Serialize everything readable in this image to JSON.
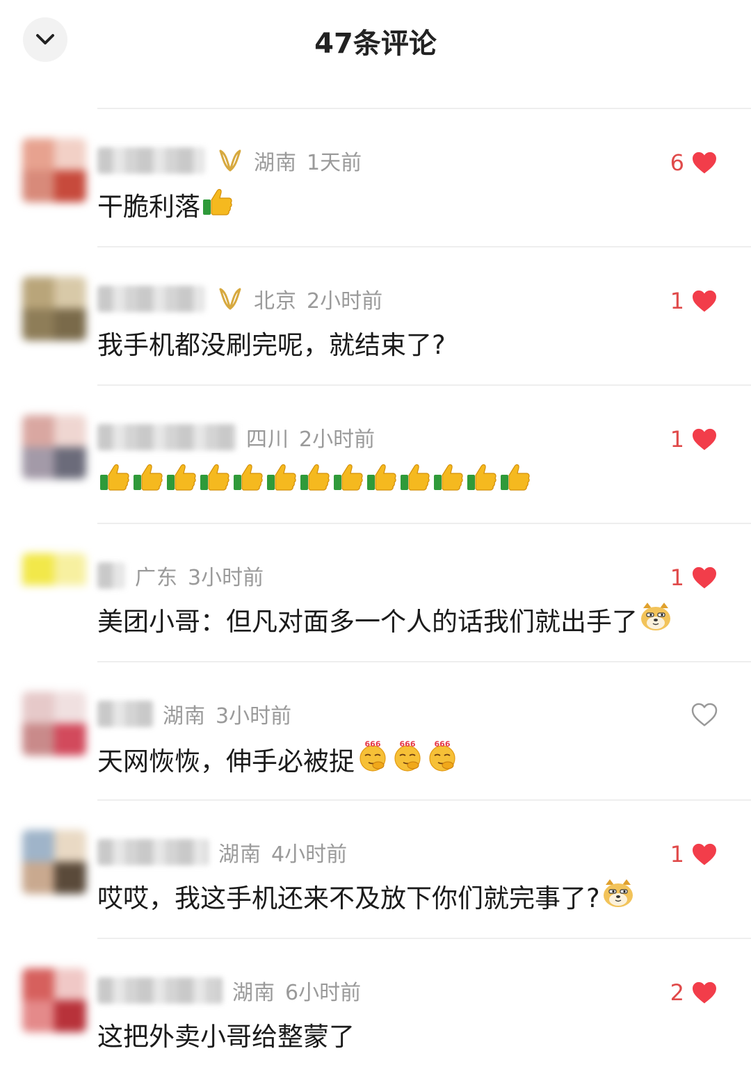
{
  "header": {
    "title": "47条评论",
    "back_icon": "chevron-down-icon"
  },
  "colors": {
    "heart_filled": "#f23d4a",
    "heart_empty": "#999999",
    "count": "#e04a4a",
    "badge_gold": "#d7a93f"
  },
  "comments": [
    {
      "location": "湖南",
      "time": "1天前",
      "text": "干脆利落",
      "emoji": "thumbs-up",
      "emoji_count": 1,
      "likes": "6",
      "liked": true,
      "badge": true
    },
    {
      "location": "北京",
      "time": "2小时前",
      "text": "我手机都没刷完呢，就结束了?",
      "emoji": "",
      "emoji_count": 0,
      "likes": "1",
      "liked": true,
      "badge": true
    },
    {
      "location": "四川",
      "time": "2小时前",
      "text": "",
      "emoji": "thumbs-up",
      "emoji_count": 13,
      "likes": "1",
      "liked": true,
      "badge": false
    },
    {
      "location": "广东",
      "time": "3小时前",
      "text": "美团小哥：但凡对面多一个人的话我们就出手了",
      "emoji": "doge",
      "emoji_count": 1,
      "likes": "1",
      "liked": true,
      "badge": false
    },
    {
      "location": "湖南",
      "time": "3小时前",
      "text": "天网恢恢，伸手必被捉",
      "emoji": "666-face",
      "emoji_count": 3,
      "likes": "",
      "liked": false,
      "badge": false
    },
    {
      "location": "湖南",
      "time": "4小时前",
      "text": "哎哎，我这手机还来不及放下你们就完事了?",
      "emoji": "doge",
      "emoji_count": 1,
      "likes": "1",
      "liked": true,
      "badge": false
    },
    {
      "location": "湖南",
      "time": "6小时前",
      "text": "这把外卖小哥给整蒙了",
      "emoji": "",
      "emoji_count": 0,
      "likes": "2",
      "liked": true,
      "badge": false
    }
  ]
}
